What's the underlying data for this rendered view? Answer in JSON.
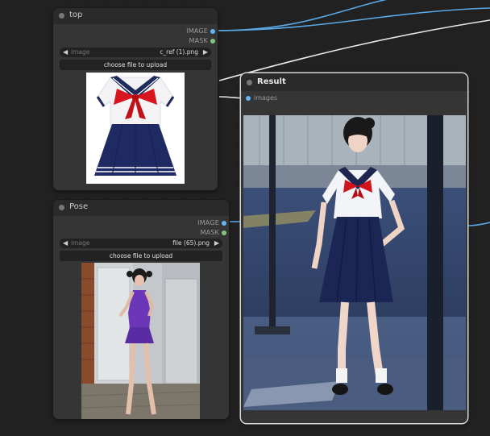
{
  "nodes": {
    "top": {
      "title": "top",
      "outputs": [
        "IMAGE",
        "MASK"
      ],
      "widget": {
        "name": "image",
        "value": "c_ref (1).png"
      },
      "upload_label": "choose file to upload",
      "preview_icon": "sailor-uniform-image"
    },
    "pose": {
      "title": "Pose",
      "outputs": [
        "IMAGE",
        "MASK"
      ],
      "widget": {
        "name": "image",
        "value": "file (65).png"
      },
      "upload_label": "choose file to upload",
      "preview_icon": "pose-photo-image"
    },
    "result": {
      "title": "Result",
      "inputs": [
        "images"
      ],
      "preview_icon": "generated-result-image"
    }
  },
  "colors": {
    "image_socket": "#64b5f6",
    "mask_socket": "#81c784",
    "link_blue": "#5aa9e6",
    "link_white": "#e8e8e8",
    "node_bg": "#353535",
    "canvas_bg": "#212121"
  }
}
